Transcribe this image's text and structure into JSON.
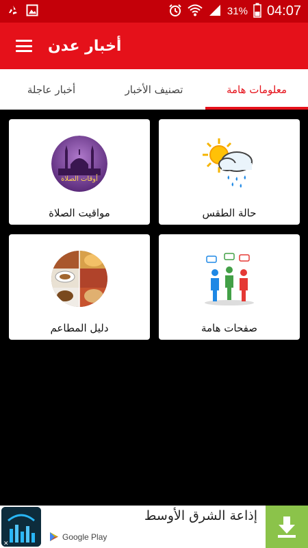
{
  "status_bar": {
    "battery_percent": "31%",
    "time": "04:07",
    "icons": [
      "recycle-icon",
      "image-icon",
      "alarm-icon",
      "wifi-icon",
      "signal-icon",
      "battery-icon"
    ]
  },
  "app_bar": {
    "title": "أخبار عدن",
    "menu_icon": "hamburger-menu-icon"
  },
  "tabs": [
    {
      "label": "معلومات هامة",
      "active": true
    },
    {
      "label": "تصنيف الأخبار",
      "active": false
    },
    {
      "label": "أخبار عاجلة",
      "active": false
    }
  ],
  "cards": [
    {
      "label": "حالة الطقس",
      "icon": "weather-icon"
    },
    {
      "label": "مواقيت الصلاة",
      "icon": "prayer-times-icon",
      "image_text": "أوقات الصلاة"
    },
    {
      "label": "صفحات هامة",
      "icon": "people-chat-icon"
    },
    {
      "label": "دليل المطاعم",
      "icon": "restaurants-food-icon"
    }
  ],
  "ad_banner": {
    "title": "إذاعة الشرق الأوسط",
    "store_label": "Google Play",
    "colors": {
      "button": "#8bc34a"
    }
  },
  "colors": {
    "status_bar": "#c40009",
    "app_bar": "#e5111a",
    "accent": "#e5111a",
    "background": "#000000"
  }
}
